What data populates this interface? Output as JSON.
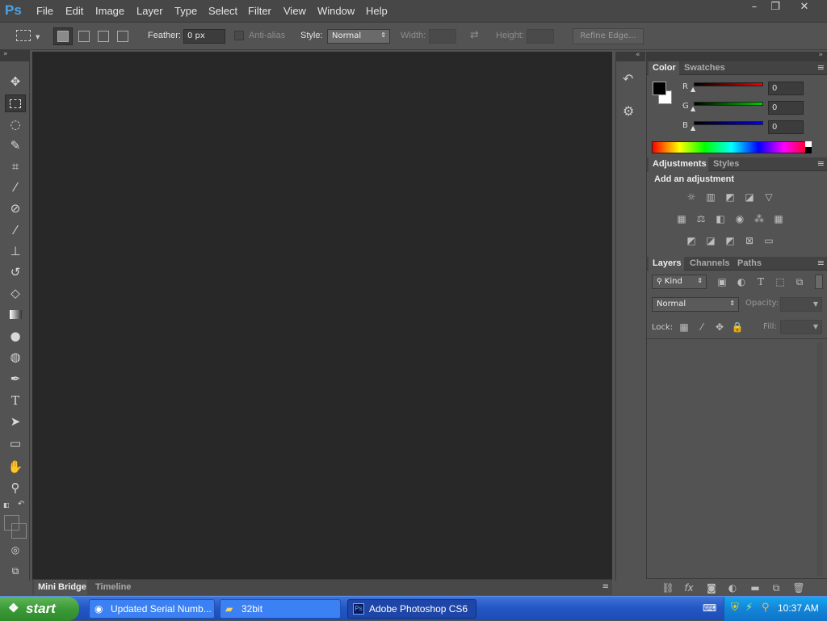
{
  "app": {
    "logo": "Ps"
  },
  "menu": [
    "File",
    "Edit",
    "Image",
    "Layer",
    "Type",
    "Select",
    "Filter",
    "View",
    "Window",
    "Help"
  ],
  "window_controls": {
    "minimize": "–",
    "restore": "❐",
    "close": "✕"
  },
  "options": {
    "feather_label": "Feather:",
    "feather_value": "0 px",
    "antialias_label": "Anti-alias",
    "style_label": "Style:",
    "style_value": "Normal",
    "width_label": "Width:",
    "height_label": "Height:",
    "refine_label": "Refine Edge..."
  },
  "tools": [
    "move-tool",
    "marquee-tool",
    "lasso-tool",
    "quick-selection-tool",
    "crop-tool",
    "eyedropper-tool",
    "healing-brush-tool",
    "brush-tool",
    "clone-stamp-tool",
    "history-brush-tool",
    "eraser-tool",
    "gradient-tool",
    "blur-tool",
    "dodge-tool",
    "pen-tool",
    "type-tool",
    "path-selection-tool",
    "shape-tool",
    "hand-tool",
    "zoom-tool"
  ],
  "colors": {
    "foreground": "#000000",
    "background": "#ffffff",
    "canvas": "#282828",
    "panel": "#535353"
  },
  "bottom_tabs": [
    "Mini Bridge",
    "Timeline"
  ],
  "color_panel": {
    "tabs": [
      "Color",
      "Swatches"
    ],
    "channels": [
      {
        "label": "R",
        "value": "0"
      },
      {
        "label": "G",
        "value": "0"
      },
      {
        "label": "B",
        "value": "0"
      }
    ]
  },
  "adjustments_panel": {
    "tabs": [
      "Adjustments",
      "Styles"
    ],
    "heading": "Add an adjustment"
  },
  "layers_panel": {
    "tabs": [
      "Layers",
      "Channels",
      "Paths"
    ],
    "kind_label": "Kind",
    "blend_mode": "Normal",
    "opacity_label": "Opacity:",
    "lock_label": "Lock:",
    "fill_label": "Fill:"
  },
  "taskbar": {
    "start_label": "start",
    "tasks": [
      "Updated Serial Numb...",
      "32bit",
      "Adobe Photoshop CS6"
    ],
    "clock": "10:37 AM"
  }
}
